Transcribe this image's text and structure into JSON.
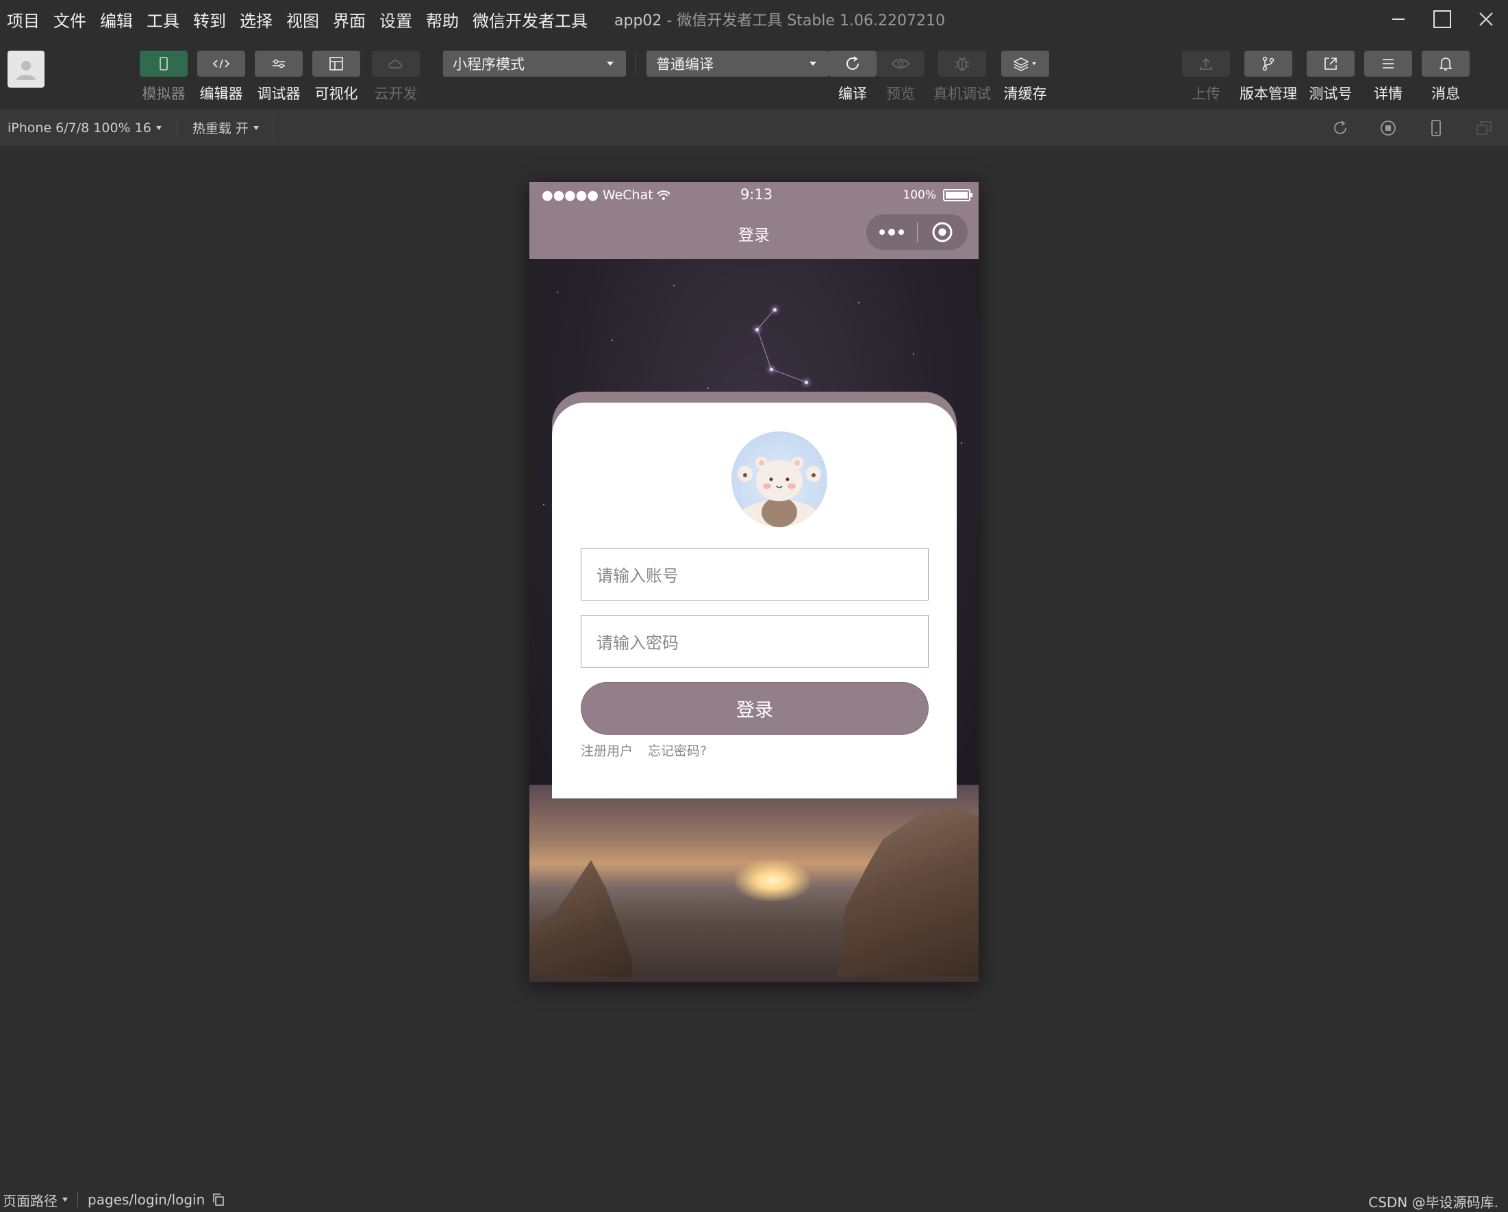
{
  "menu": [
    "项目",
    "文件",
    "编辑",
    "工具",
    "转到",
    "选择",
    "视图",
    "界面",
    "设置",
    "帮助",
    "微信开发者工具"
  ],
  "window": {
    "app_name": "app02",
    "separator": " - ",
    "product": "微信开发者工具 Stable 1.06.2207210"
  },
  "toolbar": {
    "tools_left": [
      {
        "label": "模拟器",
        "icon": "phone-icon",
        "state": "active"
      },
      {
        "label": "编辑器",
        "icon": "code-icon",
        "state": "normal"
      },
      {
        "label": "调试器",
        "icon": "debug-icon",
        "state": "normal"
      },
      {
        "label": "可视化",
        "icon": "layout-icon",
        "state": "normal"
      },
      {
        "label": "云开发",
        "icon": "cloud-icon",
        "state": "disabled"
      }
    ],
    "mode_select": "小程序模式",
    "compile_select": "普通编译",
    "tools_mid": [
      {
        "label": "编译",
        "icon": "refresh-icon",
        "state": "normal"
      },
      {
        "label": "预览",
        "icon": "eye-icon",
        "state": "disabled"
      },
      {
        "label": "真机调试",
        "icon": "bug-icon",
        "state": "disabled"
      },
      {
        "label": "清缓存",
        "icon": "layers-icon",
        "state": "normal"
      }
    ],
    "tools_right": [
      {
        "label": "上传",
        "icon": "upload-icon",
        "state": "disabled"
      },
      {
        "label": "版本管理",
        "icon": "branch-icon",
        "state": "normal"
      },
      {
        "label": "测试号",
        "icon": "external-link-icon",
        "state": "normal"
      },
      {
        "label": "详情",
        "icon": "menu-icon",
        "state": "normal"
      },
      {
        "label": "消息",
        "icon": "bell-icon",
        "state": "normal"
      }
    ]
  },
  "subbar": {
    "device": "iPhone 6/7/8 100% 16",
    "hot_reload": "热重载 开"
  },
  "simulator": {
    "status": {
      "carrier": "●●●●● WeChat",
      "time": "9:13",
      "battery": "100%"
    },
    "nav_title": "登录",
    "login": {
      "account_placeholder": "请输入账号",
      "password_placeholder": "请输入密码",
      "submit_label": "登录",
      "register_link": "注册用户",
      "forgot_link": "忘记密码?"
    }
  },
  "bottom": {
    "path_label": "页面路径",
    "path": "pages/login/login",
    "watermark": "CSDN @毕设源码库."
  },
  "colors": {
    "accent": "#937f8a",
    "ide_bg": "#2e2e2e",
    "active_tool": "#2f6b4c"
  }
}
